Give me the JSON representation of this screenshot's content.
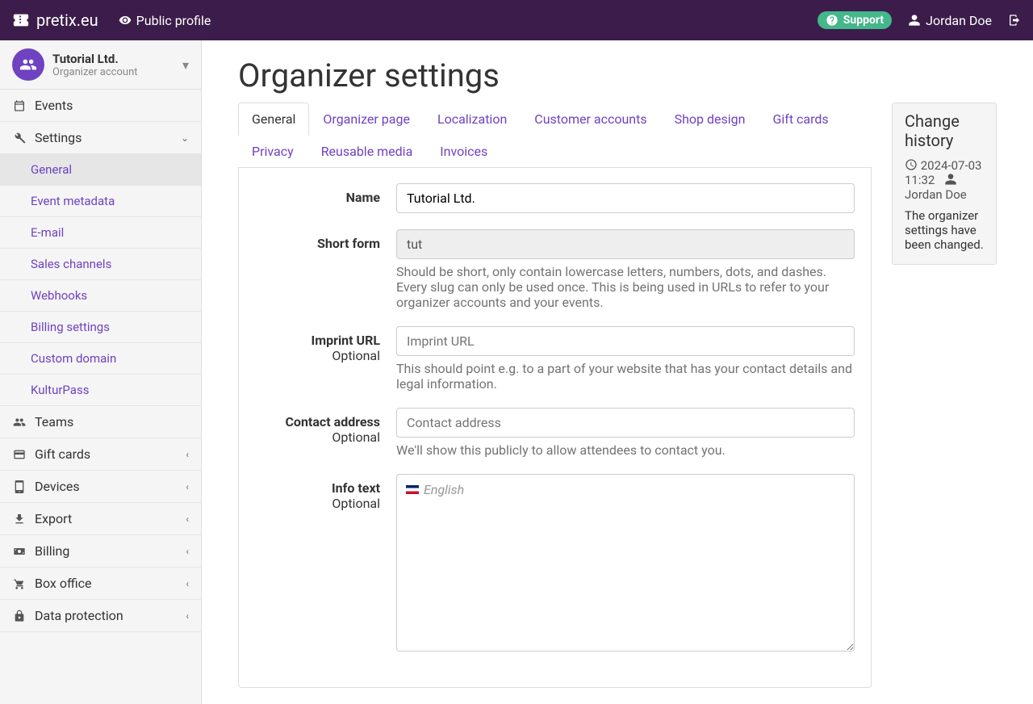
{
  "topbar": {
    "brand": "pretix.eu",
    "public_profile": "Public profile",
    "support": "Support",
    "user": "Jordan Doe"
  },
  "org": {
    "name": "Tutorial Ltd.",
    "subtitle": "Organizer account"
  },
  "sidebar": {
    "events": "Events",
    "settings": "Settings",
    "settings_sub": {
      "general": "General",
      "event_metadata": "Event metadata",
      "email": "E-mail",
      "sales_channels": "Sales channels",
      "webhooks": "Webhooks",
      "billing_settings": "Billing settings",
      "custom_domain": "Custom domain",
      "kulturpass": "KulturPass"
    },
    "teams": "Teams",
    "gift_cards": "Gift cards",
    "devices": "Devices",
    "export": "Export",
    "billing": "Billing",
    "box_office": "Box office",
    "data_protection": "Data protection"
  },
  "page": {
    "title": "Organizer settings",
    "tabs": {
      "general": "General",
      "organizer_page": "Organizer page",
      "localization": "Localization",
      "customer_accounts": "Customer accounts",
      "shop_design": "Shop design",
      "gift_cards": "Gift cards",
      "privacy": "Privacy",
      "reusable_media": "Reusable media",
      "invoices": "Invoices"
    },
    "form": {
      "name_label": "Name",
      "name_value": "Tutorial Ltd.",
      "short_label": "Short form",
      "short_value": "tut",
      "short_help": "Should be short, only contain lowercase letters, numbers, dots, and dashes. Every slug can only be used once. This is being used in URLs to refer to your organizer accounts and your events.",
      "imprint_label": "Imprint URL",
      "imprint_placeholder": "Imprint URL",
      "imprint_help": "This should point e.g. to a part of your website that has your contact details and legal information.",
      "contact_label": "Contact address",
      "contact_placeholder": "Contact address",
      "contact_help": "We'll show this publicly to allow attendees to contact you.",
      "info_label": "Info text",
      "info_lang": "English",
      "optional": "Optional"
    }
  },
  "history": {
    "title": "Change history",
    "date": "2024-07-03 11:32",
    "user": "Jordan Doe",
    "text": "The organizer settings have been changed."
  }
}
